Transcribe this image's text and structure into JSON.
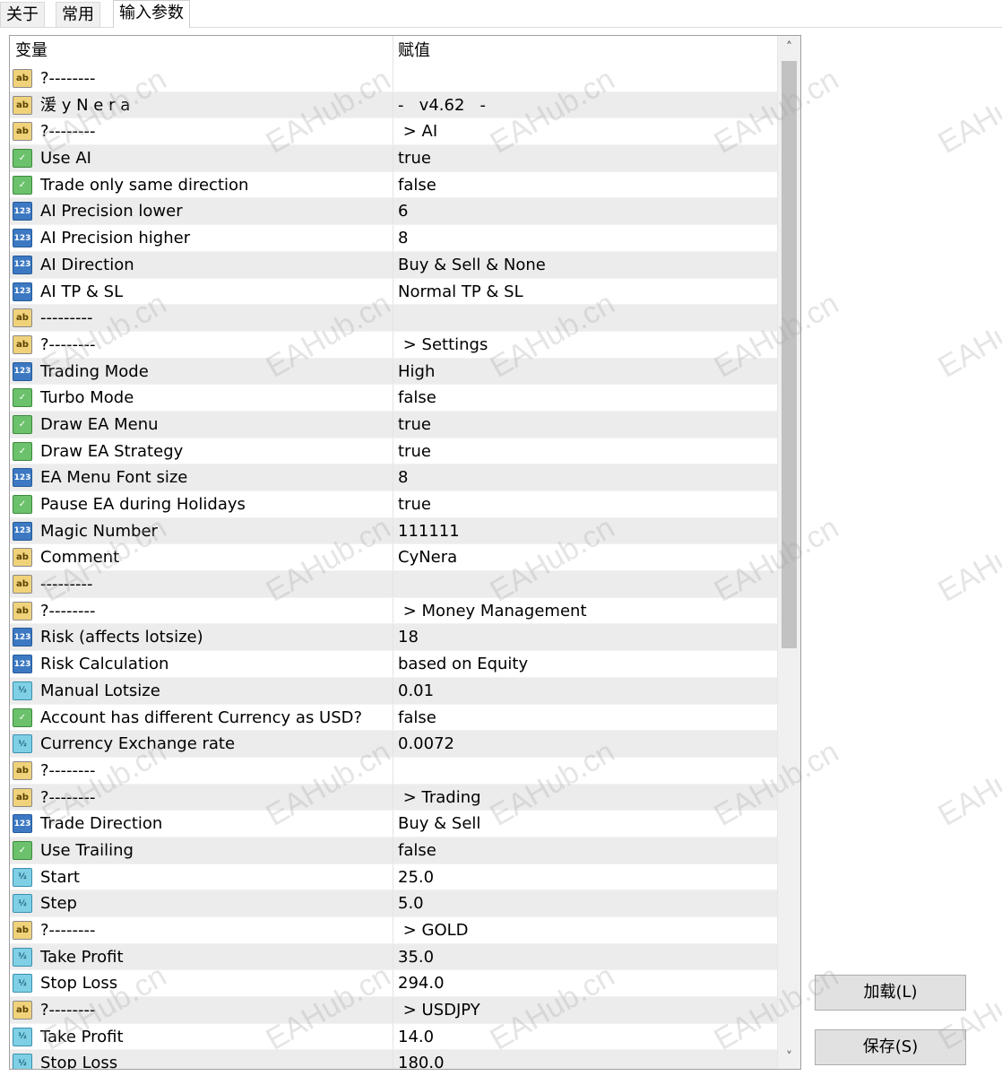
{
  "tabs": [
    "关于",
    "常用",
    "输入参数"
  ],
  "active_tab": 2,
  "columns": {
    "variable": "变量",
    "value": "赋值"
  },
  "rows": [
    {
      "type": "str",
      "name": "?--------",
      "value": ""
    },
    {
      "type": "str",
      "name": "湲 y N e r a",
      "value": "-   v4.62   -"
    },
    {
      "type": "str",
      "name": "?--------",
      "value": " > AI"
    },
    {
      "type": "bool",
      "name": "Use AI",
      "value": "true"
    },
    {
      "type": "bool",
      "name": "Trade only same direction",
      "value": "false"
    },
    {
      "type": "int",
      "name": "AI Precision lower",
      "value": "6"
    },
    {
      "type": "int",
      "name": "AI Precision higher",
      "value": "8"
    },
    {
      "type": "int",
      "name": "AI Direction",
      "value": "Buy & Sell & None"
    },
    {
      "type": "int",
      "name": "AI TP & SL",
      "value": "Normal TP & SL"
    },
    {
      "type": "str",
      "name": "---------",
      "value": ""
    },
    {
      "type": "str",
      "name": "?--------",
      "value": " > Settings"
    },
    {
      "type": "int",
      "name": "Trading Mode",
      "value": "High"
    },
    {
      "type": "bool",
      "name": "Turbo Mode",
      "value": "false"
    },
    {
      "type": "bool",
      "name": "Draw EA Menu",
      "value": "true"
    },
    {
      "type": "bool",
      "name": "Draw EA Strategy",
      "value": "true"
    },
    {
      "type": "int",
      "name": "EA Menu Font size",
      "value": "8"
    },
    {
      "type": "bool",
      "name": "Pause EA during Holidays",
      "value": "true"
    },
    {
      "type": "int",
      "name": "Magic Number",
      "value": "111111"
    },
    {
      "type": "str",
      "name": "Comment",
      "value": "CyNera"
    },
    {
      "type": "str",
      "name": "---------",
      "value": ""
    },
    {
      "type": "str",
      "name": "?--------",
      "value": " > Money Management"
    },
    {
      "type": "int",
      "name": "Risk (affects lotsize)",
      "value": "18"
    },
    {
      "type": "int",
      "name": "Risk Calculation",
      "value": "based on Equity"
    },
    {
      "type": "dbl",
      "name": "Manual Lotsize",
      "value": "0.01"
    },
    {
      "type": "bool",
      "name": "Account has different Currency as USD?",
      "value": "false"
    },
    {
      "type": "dbl",
      "name": "Currency Exchange rate",
      "value": "0.0072"
    },
    {
      "type": "str",
      "name": "?--------",
      "value": ""
    },
    {
      "type": "str",
      "name": "?--------",
      "value": " > Trading"
    },
    {
      "type": "int",
      "name": "Trade Direction",
      "value": "Buy & Sell"
    },
    {
      "type": "bool",
      "name": "Use Trailing",
      "value": "false"
    },
    {
      "type": "dbl",
      "name": "Start",
      "value": "25.0"
    },
    {
      "type": "dbl",
      "name": "Step",
      "value": "5.0"
    },
    {
      "type": "str",
      "name": "?--------",
      "value": " > GOLD"
    },
    {
      "type": "dbl",
      "name": "Take Profit",
      "value": "35.0"
    },
    {
      "type": "dbl",
      "name": "Stop Loss",
      "value": "294.0"
    },
    {
      "type": "str",
      "name": "?--------",
      "value": " > USDJPY"
    },
    {
      "type": "dbl",
      "name": "Take Profit",
      "value": "14.0"
    },
    {
      "type": "dbl",
      "name": "Stop Loss",
      "value": "180.0"
    }
  ],
  "icon_glyphs": {
    "str": "ab",
    "bool": "✓",
    "int": "123",
    "dbl": "½"
  },
  "icon_names": {
    "str": "string-type-icon",
    "bool": "boolean-type-icon",
    "int": "integer-type-icon",
    "dbl": "double-type-icon"
  },
  "buttons": {
    "load": "加载(L)",
    "save": "保存(S)"
  },
  "watermark": "EAHub.cn"
}
